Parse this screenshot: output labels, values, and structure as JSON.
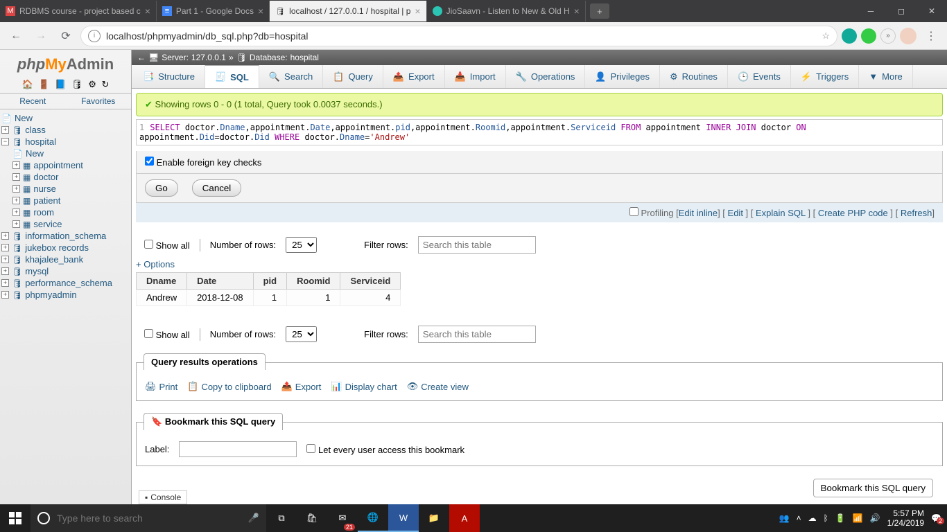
{
  "browser": {
    "tabs": [
      {
        "label": "RDBMS course - project based c"
      },
      {
        "label": "Part 1 - Google Docs"
      },
      {
        "label": "localhost / 127.0.0.1 / hospital | p"
      },
      {
        "label": "JioSaavn - Listen to New & Old H"
      }
    ],
    "url": "localhost/phpmyadmin/db_sql.php?db=hospital"
  },
  "sidebar": {
    "tabs": {
      "recent": "Recent",
      "favorites": "Favorites"
    },
    "new": "New",
    "dbs": [
      "class",
      "hospital",
      "information_schema",
      "jukebox records",
      "khajalee_bank",
      "mysql",
      "performance_schema",
      "phpmyadmin"
    ],
    "hospital": {
      "new": "New",
      "tables": [
        "appointment",
        "doctor",
        "nurse",
        "patient",
        "room",
        "service"
      ]
    }
  },
  "breadcrumb": {
    "server_label": "Server:",
    "server": "127.0.0.1",
    "db_label": "Database:",
    "db": "hospital"
  },
  "tabs": [
    "Structure",
    "SQL",
    "Search",
    "Query",
    "Export",
    "Import",
    "Operations",
    "Privileges",
    "Routines",
    "Events",
    "Triggers",
    "More"
  ],
  "success_msg": "Showing rows 0 - 0 (1 total, Query took 0.0037 seconds.)",
  "sql": {
    "line": "1",
    "full": "SELECT doctor.Dname,appointment.Date,appointment.pid,appointment.Roomid,appointment.Serviceid FROM appointment INNER JOIN doctor ON appointment.Did=doctor.Did WHERE doctor.Dname='Andrew'"
  },
  "fk_label": "Enable foreign key checks",
  "go": "Go",
  "cancel": "Cancel",
  "profiling": "Profiling",
  "links": {
    "edit_inline": "Edit inline",
    "edit": "Edit",
    "explain": "Explain SQL",
    "php": "Create PHP code",
    "refresh": "Refresh"
  },
  "controls": {
    "show_all": "Show all",
    "rows_label": "Number of rows:",
    "rows_value": "25",
    "filter_label": "Filter rows:",
    "filter_placeholder": "Search this table"
  },
  "options": "+ Options",
  "result": {
    "headers": [
      "Dname",
      "Date",
      "pid",
      "Roomid",
      "Serviceid"
    ],
    "row": {
      "Dname": "Andrew",
      "Date": "2018-12-08",
      "pid": "1",
      "Roomid": "1",
      "Serviceid": "4"
    }
  },
  "ops": {
    "title": "Query results operations",
    "print": "Print",
    "copy": "Copy to clipboard",
    "export": "Export",
    "chart": "Display chart",
    "view": "Create view"
  },
  "bookmark": {
    "title": "Bookmark this SQL query",
    "label": "Label:",
    "share": "Let every user access this bookmark",
    "button": "Bookmark this SQL query"
  },
  "console": "Console",
  "taskbar": {
    "search_placeholder": "Type here to search",
    "time": "5:57 PM",
    "date": "1/24/2019",
    "badge1": "21",
    "badge2": "2"
  }
}
